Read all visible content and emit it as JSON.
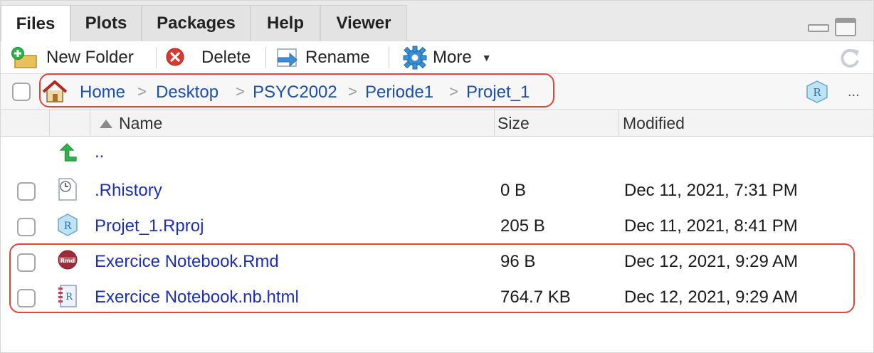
{
  "tabs": [
    {
      "label": "Files",
      "active": true
    },
    {
      "label": "Plots",
      "active": false
    },
    {
      "label": "Packages",
      "active": false
    },
    {
      "label": "Help",
      "active": false
    },
    {
      "label": "Viewer",
      "active": false
    }
  ],
  "toolbar": {
    "new_folder": "New Folder",
    "delete": "Delete",
    "rename": "Rename",
    "more": "More"
  },
  "breadcrumb": {
    "home": "Home",
    "items": [
      "Desktop",
      "PSYC2002",
      "Periode1",
      "Projet_1"
    ],
    "more": "..."
  },
  "columns": {
    "name": "Name",
    "size": "Size",
    "modified": "Modified",
    "sort": "ascending"
  },
  "parent_dir": "..",
  "files": [
    {
      "name": ".Rhistory",
      "size": "0 B",
      "modified": "Dec 11, 2021, 7:31 PM",
      "icon": "history-file-icon"
    },
    {
      "name": "Projet_1.Rproj",
      "size": "205 B",
      "modified": "Dec 11, 2021, 8:41 PM",
      "icon": "rproj-file-icon"
    },
    {
      "name": "Exercice Notebook.Rmd",
      "size": "96 B",
      "modified": "Dec 12, 2021, 9:29 AM",
      "icon": "rmd-file-icon"
    },
    {
      "name": "Exercice Notebook.nb.html",
      "size": "764.7 KB",
      "modified": "Dec 12, 2021, 9:29 AM",
      "icon": "notebook-file-icon"
    }
  ],
  "colors": {
    "link": "#1b2fb5",
    "highlight": "#e2453a",
    "accent_green": "#2db34a"
  }
}
